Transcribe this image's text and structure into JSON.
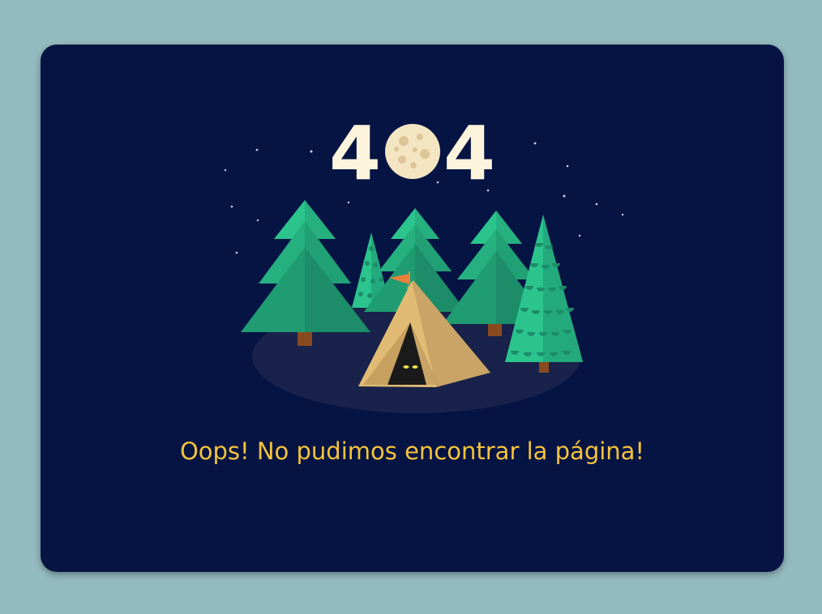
{
  "error_code": {
    "first_digit": "4",
    "last_digit": "4"
  },
  "message": "Oops! No pudimos encontrar la página!",
  "colors": {
    "page_background": "#93babf",
    "card_background": "#061443",
    "message_text": "#f5c33b",
    "digits": "#fcf4dc",
    "moon": "#f4e5c2",
    "tree_light": "#2bc48d",
    "tree_dark": "#1d8d68",
    "tent": "#d9b06c",
    "flag": "#e9803a"
  }
}
